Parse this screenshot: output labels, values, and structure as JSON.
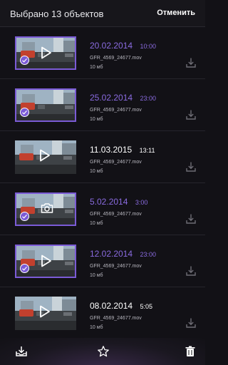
{
  "header": {
    "title": "Выбрано 13 объектов",
    "cancel_label": "Отменить"
  },
  "colors": {
    "accent": "#7b5bd6",
    "background": "#121116",
    "text_muted": "#b8b7bf"
  },
  "items": [
    {
      "date": "20.02.2014",
      "time": "10:00",
      "filename": "GFR_4569_24677.mov",
      "size": "10 мб",
      "selected": true,
      "type_icon": "play-icon"
    },
    {
      "date": "25.02.2014",
      "time": "23:00",
      "filename": "GFR_4569_24677.mov",
      "size": "10 мб",
      "selected": true,
      "type_icon": "none"
    },
    {
      "date": "11.03.2015",
      "time": "13:11",
      "filename": "GFR_4569_24677.mov",
      "size": "10 мб",
      "selected": false,
      "type_icon": "play-icon"
    },
    {
      "date": "5.02.2014",
      "time": "3:00",
      "filename": "GFR_4569_24677.mov",
      "size": "10 мб",
      "selected": true,
      "type_icon": "camera-icon"
    },
    {
      "date": "12.02.2014",
      "time": "23:00",
      "filename": "GFR_4569_24677.mov",
      "size": "10 мб",
      "selected": true,
      "type_icon": "play-icon"
    },
    {
      "date": "08.02.2014",
      "time": "5:05",
      "filename": "GFR_4569_24677.mov",
      "size": "10 мб",
      "selected": false,
      "type_icon": "play-icon"
    }
  ],
  "bottom_bar": {
    "icons": [
      "download-tray-icon",
      "star-icon",
      "trash-icon"
    ]
  }
}
